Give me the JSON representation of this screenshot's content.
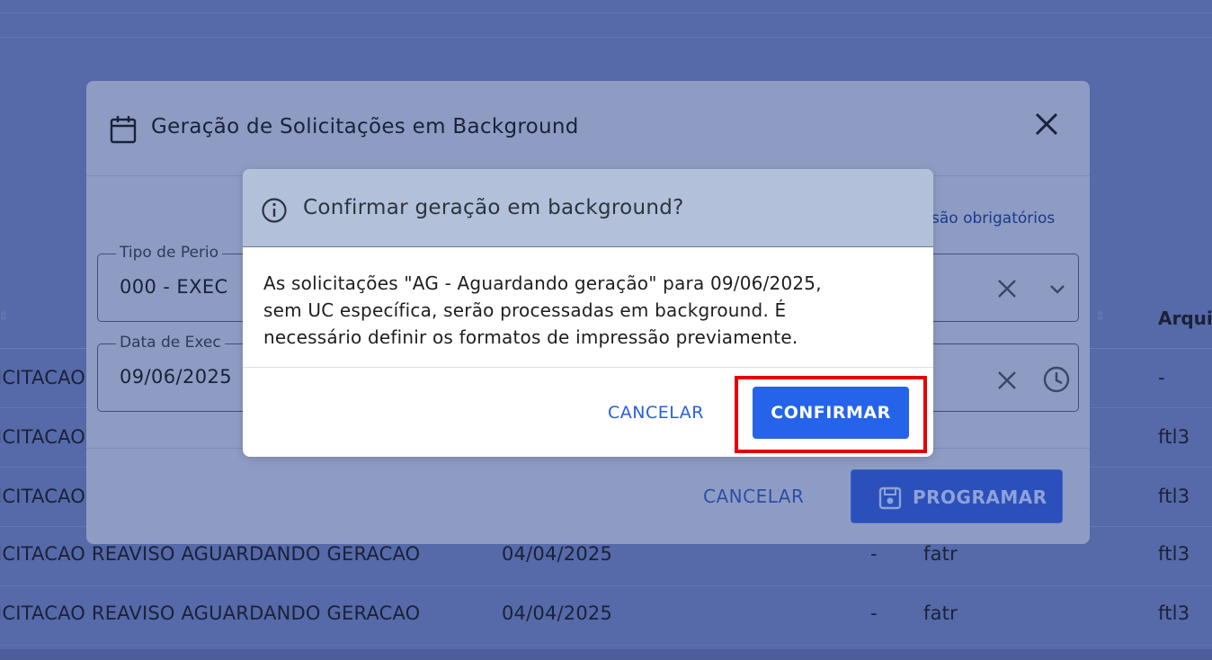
{
  "background_table": {
    "header": {
      "col_arqui": "Arqui"
    },
    "rows": [
      {
        "desc": "ICITACAO",
        "date": "",
        "dash": "",
        "type": "",
        "file": "-"
      },
      {
        "desc": "ICITACAO",
        "date": "",
        "dash": "",
        "type": "",
        "file": "ftl3"
      },
      {
        "desc": "ICITACAO",
        "date": "",
        "dash": "",
        "type": "",
        "file": "ftl3"
      },
      {
        "desc": "ICITACAO REAVISO AGUARDANDO GERACAO",
        "date": "04/04/2025",
        "dash": "-",
        "type": "fatr",
        "file": "ftl3"
      },
      {
        "desc": "ICITACAO REAVISO AGUARDANDO GERACAO",
        "date": "04/04/2025",
        "dash": "-",
        "type": "fatr",
        "file": "ftl3"
      }
    ]
  },
  "outer_modal": {
    "title": "Geração de Solicitações em Background",
    "required_note": "são obrigatórios",
    "field_periodo": {
      "label": "Tipo de Perio",
      "value": "000 - EXEC"
    },
    "field_data": {
      "label": "Data de Exec",
      "value": "09/06/2025"
    },
    "cancel_label": "CANCELAR",
    "program_label": "PROGRAMAR"
  },
  "confirm_dialog": {
    "title": "Confirmar geração em background?",
    "message_line1": "As solicitações \"AG - Aguardando geração\" para 09/06/2025,",
    "message_line2": "sem UC específica, serão processadas em background. É",
    "message_line3": "necessário definir os formatos de impressão previamente.",
    "cancel_label": "CANCELAR",
    "confirm_label": "CONFIRMAR"
  },
  "colors": {
    "overlay": "#5669a8",
    "modal_bg": "#8e9cc4",
    "confirm_header": "#b3c0d9",
    "primary": "#2563eb",
    "highlight": "#e60000"
  }
}
